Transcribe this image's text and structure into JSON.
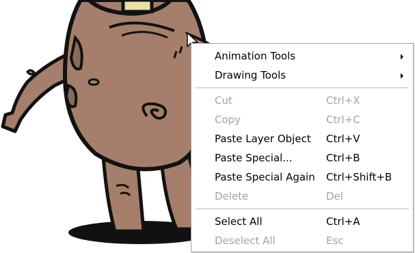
{
  "context_menu": {
    "items": [
      {
        "label": "Animation Tools",
        "shortcut": "",
        "submenu": true,
        "enabled": true
      },
      {
        "label": "Drawing Tools",
        "shortcut": "",
        "submenu": true,
        "enabled": true
      },
      {
        "label": "Cut",
        "shortcut": "Ctrl+X",
        "submenu": false,
        "enabled": false
      },
      {
        "label": "Copy",
        "shortcut": "Ctrl+C",
        "submenu": false,
        "enabled": false
      },
      {
        "label": "Paste Layer Object",
        "shortcut": "Ctrl+V",
        "submenu": false,
        "enabled": true
      },
      {
        "label": "Paste Special...",
        "shortcut": "Ctrl+B",
        "submenu": false,
        "enabled": true
      },
      {
        "label": "Paste Special Again",
        "shortcut": "Ctrl+Shift+B",
        "submenu": false,
        "enabled": true
      },
      {
        "label": "Delete",
        "shortcut": "Del",
        "submenu": false,
        "enabled": false
      },
      {
        "label": "Select All",
        "shortcut": "Ctrl+A",
        "submenu": false,
        "enabled": true
      },
      {
        "label": "Deselect All",
        "shortcut": "Esc",
        "submenu": false,
        "enabled": false
      }
    ]
  },
  "colors": {
    "character_fill": "#a57f6b",
    "character_outline": "#121212",
    "character_accent": "#e7e1a3",
    "disabled_text": "#a3a3a3"
  },
  "icons": {
    "pointer": "mouse-pointer-icon",
    "submenu_arrow": "chevron-right-icon"
  }
}
